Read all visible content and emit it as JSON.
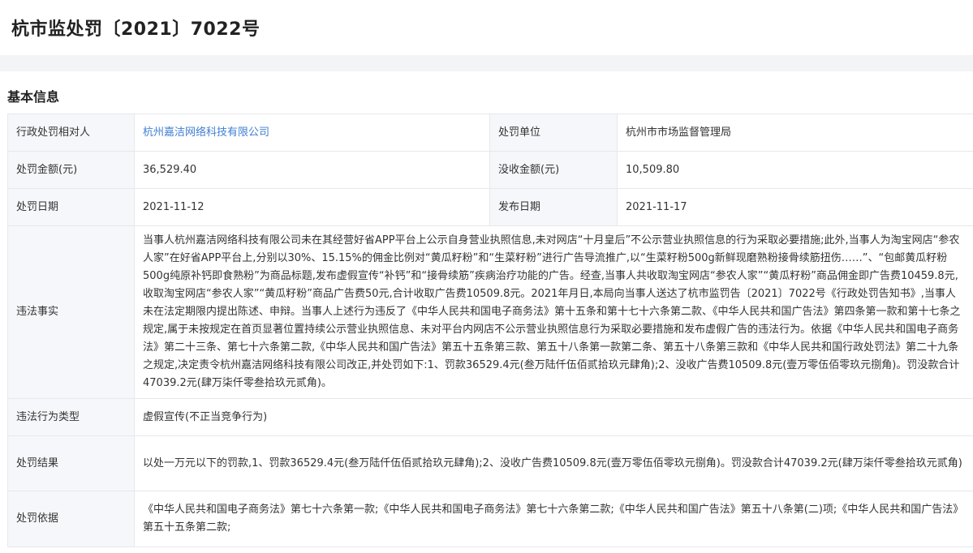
{
  "page": {
    "title": "杭市监处罚〔2021〕7022号"
  },
  "section": {
    "title": "基本信息"
  },
  "table": {
    "party_label": "行政处罚相对人",
    "party_value": "杭州嘉洁网络科技有限公司",
    "unit_label": "处罚单位",
    "unit_value": "杭州市市场监督管理局",
    "amount_label": "处罚金额(元)",
    "amount_value": "36,529.40",
    "confiscate_label": "没收金额(元)",
    "confiscate_value": "10,509.80",
    "date_label": "处罚日期",
    "date_value": "2021-11-12",
    "publish_label": "发布日期",
    "publish_value": "2021-11-17",
    "facts_label": "违法事实",
    "facts_value": "当事人杭州嘉洁网络科技有限公司未在其经营好省APP平台上公示自身营业执照信息,未对网店“十月皇后”不公示营业执照信息的行为采取必要措施;此外,当事人为淘宝网店“参农人家”在好省APP平台上,分别以30%、15.15%的佣金比例对“黄瓜籽粉”和“生菜籽粉”进行广告导流推广,以“生菜籽粉500g新鲜现磨熟粉接骨续筋扭伤……”、“包邮黄瓜籽粉500g纯原补钙即食熟粉”为商品标题,发布虚假宣传“补钙”和“接骨续筋”疾病治疗功能的广告。经查,当事人共收取淘宝网店“参农人家”“黄瓜籽粉”商品佣金即广告费10459.8元,收取淘宝网店“参农人家”“黄瓜籽粉”商品广告费50元,合计收取广告费10509.8元。2021年月日,本局向当事人送达了杭市监罚告〔2021〕7022号《行政处罚告知书》,当事人未在法定期限内提出陈述、申辩。当事人上述行为违反了《中华人民共和国电子商务法》第十五条和第十七十六条第二款、《中华人民共和国广告法》第四条第一款和第十七条之规定,属于未按规定在首页显著位置持续公示营业执照信息、未对平台内网店不公示营业执照信息行为采取必要措施和发布虚假广告的违法行为。依据《中华人民共和国电子商务法》第二十三条、第七十六条第二款,《中华人民共和国广告法》第五十五条第三款、第五十八条第一款第二条、第五十八条第三款和《中华人民共和国行政处罚法》第二十九条之规定,决定责令杭州嘉洁网络科技有限公司改正,并处罚如下:1、罚款36529.4元(叁万陆仟伍佰贰拾玖元肆角);2、没收广告费10509.8元(壹万零伍佰零玖元捌角)。罚没款合计47039.2元(肆万柒仟零叁拾玖元贰角)。",
    "type_label": "违法行为类型",
    "type_value": "虚假宣传(不正当竞争行为)",
    "result_label": "处罚结果",
    "result_value": "以处一万元以下的罚款,1、罚款36529.4元(叁万陆仟伍佰贰拾玖元肆角);2、没收广告费10509.8元(壹万零伍佰零玖元捌角)。罚没款合计47039.2元(肆万柒仟零叁拾玖元贰角)",
    "basis_label": "处罚依据",
    "basis_value": "《中华人民共和国电子商务法》第七十六条第一款;《中华人民共和国电子商务法》第七十六条第二款;《中华人民共和国广告法》第五十八条第(二)项;《中华人民共和国广告法》第五十五条第二款;"
  },
  "colors": {
    "link": "#3f7fd1",
    "label_bg": "#f5f7fa",
    "border": "#e6e8eb",
    "band": "#f3f4f6"
  }
}
